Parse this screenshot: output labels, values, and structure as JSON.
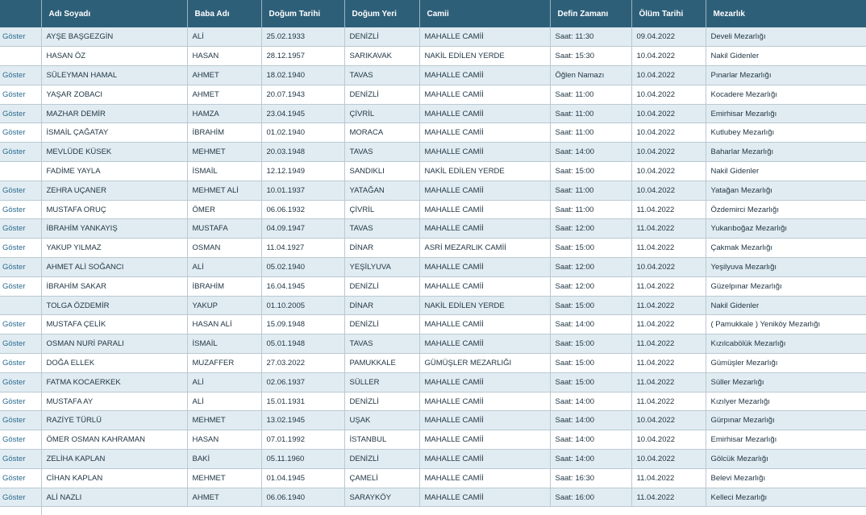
{
  "table": {
    "columns": [
      "",
      "Adı Soyadı",
      "Baba Adı",
      "Doğum Tarihi",
      "Doğum Yeri",
      "Camii",
      "Defin Zamanı",
      "Ölüm Tarihi",
      "Mezarlık"
    ],
    "rows": [
      {
        "action": "Göster",
        "cells": [
          "AYŞE BAŞGEZGİN",
          "ALİ",
          "25.02.1933",
          "DENİZLİ",
          "MAHALLE CAMİİ",
          "Saat: 11:30",
          "09.04.2022",
          "Develi Mezarlığı"
        ]
      },
      {
        "action": "",
        "cells": [
          "HASAN ÖZ",
          "HASAN",
          "28.12.1957",
          "SARIKAVAK",
          "NAKİL EDİLEN YERDE",
          "Saat: 15:30",
          "10.04.2022",
          "Nakil Gidenler"
        ]
      },
      {
        "action": "Göster",
        "cells": [
          "SÜLEYMAN HAMAL",
          "AHMET",
          "18.02.1940",
          "TAVAS",
          "MAHALLE CAMİİ",
          "Öğlen Namazı",
          "10.04.2022",
          "Pınarlar Mezarlığı"
        ]
      },
      {
        "action": "Göster",
        "cells": [
          "YAŞAR ZOBACI",
          "AHMET",
          "20.07.1943",
          "DENİZLİ",
          "MAHALLE CAMİİ",
          "Saat: 11:00",
          "10.04.2022",
          "Kocadere Mezarlığı"
        ]
      },
      {
        "action": "Göster",
        "cells": [
          "MAZHAR DEMİR",
          "HAMZA",
          "23.04.1945",
          "ÇİVRİL",
          "MAHALLE CAMİİ",
          "Saat: 11:00",
          "10.04.2022",
          "Emirhisar Mezarlığı"
        ]
      },
      {
        "action": "Göster",
        "cells": [
          "İSMAİL ÇAĞATAY",
          "İBRAHİM",
          "01.02.1940",
          "MORACA",
          "MAHALLE CAMİİ",
          "Saat: 11:00",
          "10.04.2022",
          "Kutlubey Mezarlığı"
        ]
      },
      {
        "action": "Göster",
        "cells": [
          "MEVLÜDE KÜSEK",
          "MEHMET",
          "20.03.1948",
          "TAVAS",
          "MAHALLE CAMİİ",
          "Saat: 14:00",
          "10.04.2022",
          "Baharlar Mezarlığı"
        ]
      },
      {
        "action": "",
        "cells": [
          "FADİME YAYLA",
          "İSMAİL",
          "12.12.1949",
          "SANDIKLI",
          "NAKİL EDİLEN YERDE",
          "Saat: 15:00",
          "10.04.2022",
          "Nakil Gidenler"
        ]
      },
      {
        "action": "Göster",
        "cells": [
          "ZEHRA UÇANER",
          "MEHMET ALİ",
          "10.01.1937",
          "YATAĞAN",
          "MAHALLE CAMİİ",
          "Saat: 11:00",
          "10.04.2022",
          "Yatağan Mezarlığı"
        ]
      },
      {
        "action": "Göster",
        "cells": [
          "MUSTAFA ORUÇ",
          "ÖMER",
          "06.06.1932",
          "ÇİVRİL",
          "MAHALLE CAMİİ",
          "Saat: 11:00",
          "11.04.2022",
          "Özdemirci Mezarlığı"
        ]
      },
      {
        "action": "Göster",
        "cells": [
          "İBRAHİM YANKAYIŞ",
          "MUSTAFA",
          "04.09.1947",
          "TAVAS",
          "MAHALLE CAMİİ",
          "Saat: 12:00",
          "11.04.2022",
          "Yukarıboğaz Mezarlığı"
        ]
      },
      {
        "action": "Göster",
        "cells": [
          "YAKUP YILMAZ",
          "OSMAN",
          "11.04.1927",
          "DİNAR",
          "ASRİ MEZARLIK CAMİİ",
          "Saat: 15:00",
          "11.04.2022",
          "Çakmak Mezarlığı"
        ]
      },
      {
        "action": "Göster",
        "cells": [
          "AHMET ALİ SOĞANCI",
          "ALİ",
          "05.02.1940",
          "YEŞİLYUVA",
          "MAHALLE CAMİİ",
          "Saat: 12:00",
          "10.04.2022",
          "Yeşilyuva Mezarlığı"
        ]
      },
      {
        "action": "Göster",
        "cells": [
          "İBRAHİM SAKAR",
          "İBRAHİM",
          "16.04.1945",
          "DENİZLİ",
          "MAHALLE CAMİİ",
          "Saat: 12:00",
          "11.04.2022",
          "Güzelpınar Mezarlığı"
        ]
      },
      {
        "action": "",
        "cells": [
          "TOLGA ÖZDEMİR",
          "YAKUP",
          "01.10.2005",
          "DİNAR",
          "NAKİL EDİLEN YERDE",
          "Saat: 15:00",
          "11.04.2022",
          "Nakil Gidenler"
        ]
      },
      {
        "action": "Göster",
        "cells": [
          "MUSTAFA ÇELİK",
          "HASAN ALİ",
          "15.09.1948",
          "DENİZLİ",
          "MAHALLE CAMİİ",
          "Saat: 14:00",
          "11.04.2022",
          "( Pamukkale ) Yeniköy Mezarlığı"
        ]
      },
      {
        "action": "Göster",
        "cells": [
          "OSMAN NURİ PARALI",
          "İSMAİL",
          "05.01.1948",
          "TAVAS",
          "MAHALLE CAMİİ",
          "Saat: 15:00",
          "11.04.2022",
          "Kızılcabölük Mezarlığı"
        ]
      },
      {
        "action": "Göster",
        "cells": [
          "DOĞA ELLEK",
          "MUZAFFER",
          "27.03.2022",
          "PAMUKKALE",
          "GÜMÜŞLER MEZARLIĞI",
          "Saat: 15:00",
          "11.04.2022",
          "Gümüşler Mezarlığı"
        ]
      },
      {
        "action": "Göster",
        "cells": [
          "FATMA KOCAERKEK",
          "ALİ",
          "02.06.1937",
          "SÜLLER",
          "MAHALLE CAMİİ",
          "Saat: 15:00",
          "11.04.2022",
          "Süller Mezarlığı"
        ]
      },
      {
        "action": "Göster",
        "cells": [
          "MUSTAFA AY",
          "ALİ",
          "15.01.1931",
          "DENİZLİ",
          "MAHALLE CAMİİ",
          "Saat: 14:00",
          "11.04.2022",
          "Kızılyer Mezarlığı"
        ]
      },
      {
        "action": "Göster",
        "cells": [
          "RAZİYE TÜRLÜ",
          "MEHMET",
          "13.02.1945",
          "UŞAK",
          "MAHALLE CAMİİ",
          "Saat: 14:00",
          "10.04.2022",
          "Gürpınar Mezarlığı"
        ]
      },
      {
        "action": "Göster",
        "cells": [
          "ÖMER OSMAN KAHRAMAN",
          "HASAN",
          "07.01.1992",
          "İSTANBUL",
          "MAHALLE CAMİİ",
          "Saat: 14:00",
          "10.04.2022",
          "Emirhisar Mezarlığı"
        ]
      },
      {
        "action": "Göster",
        "cells": [
          "ZELİHA KAPLAN",
          "BAKİ",
          "05.11.1960",
          "DENİZLİ",
          "MAHALLE CAMİİ",
          "Saat: 14:00",
          "10.04.2022",
          "Gölcük Mezarlığı"
        ]
      },
      {
        "action": "Göster",
        "cells": [
          "CİHAN KAPLAN",
          "MEHMET",
          "01.04.1945",
          "ÇAMELİ",
          "MAHALLE CAMİİ",
          "Saat: 16:30",
          "11.04.2022",
          "Belevi Mezarlığı"
        ]
      },
      {
        "action": "Göster",
        "cells": [
          "ALİ NAZLI",
          "AHMET",
          "06.06.1940",
          "SARAYKÖY",
          "MAHALLE CAMİİ",
          "Saat: 16:00",
          "11.04.2022",
          "Kelleci Mezarlığı"
        ]
      }
    ]
  }
}
